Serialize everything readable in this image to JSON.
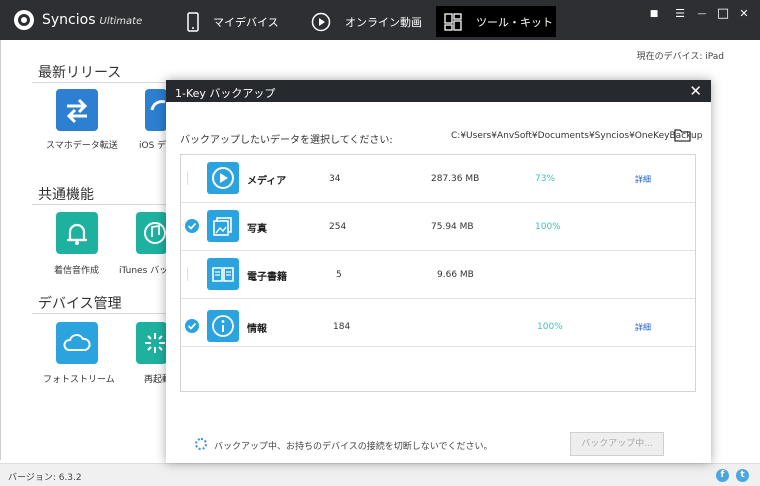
{
  "app": {
    "name": "Syncios",
    "edition": "Ultimate"
  },
  "nav": {
    "tabs": [
      {
        "label": "マイデバイス",
        "icon": "phone-icon"
      },
      {
        "label": "オンライン動画",
        "icon": "play-circle-icon"
      },
      {
        "label": "ツール・キット",
        "icon": "toolkit-icon"
      }
    ],
    "active_tab": 2
  },
  "window_controls": {
    "feedback": "■",
    "menu": "☰",
    "minimize": "—",
    "maximize": "□",
    "close": "✕"
  },
  "page": {
    "current_device": "現在のデバイス: iPad",
    "sections": [
      {
        "title": "最新リリース",
        "tools": [
          {
            "label": "スマホデータ転送",
            "icon": "transfer-arrows-icon",
            "color": "#2c7fd1"
          },
          {
            "label": "iOS デー",
            "icon": "ios-restore-icon",
            "color": "#2c7fd1"
          }
        ]
      },
      {
        "title": "共通機能",
        "tools": [
          {
            "label": "着信音作成",
            "icon": "bell-icon",
            "color": "#1fb1a0"
          },
          {
            "label": "iTunes バック",
            "icon": "music-note-icon",
            "color": "#1fb1a0"
          }
        ]
      },
      {
        "title": "デバイス管理",
        "tools": [
          {
            "label": "フォトストリーム",
            "icon": "cloud-icon",
            "color": "#2aa3df"
          },
          {
            "label": "再起動",
            "icon": "restart-icon",
            "color": "#1fb1a0"
          }
        ]
      }
    ]
  },
  "status_bar": {
    "version": "バージョン: 6.3.2",
    "social": [
      {
        "icon": "facebook-icon",
        "glyph": "f"
      },
      {
        "icon": "twitter-icon",
        "glyph": "t"
      }
    ]
  },
  "dialog": {
    "title": "1-Key バックアップ",
    "close": "✕",
    "prompt": "バックアップしたいデータを選択してください:",
    "path": "C:¥Users¥AnvSoft¥Documents¥Syncios¥OneKeyBackup",
    "rows": [
      {
        "name": "メディア",
        "count": "34",
        "size": "287.36 MB",
        "progress": "73%",
        "detail": "詳細",
        "checked": false,
        "icon": "media-play-icon"
      },
      {
        "name": "写真",
        "count": "254",
        "size": "75.94 MB",
        "progress": "100%",
        "detail": "",
        "checked": true,
        "icon": "photo-icon"
      },
      {
        "name": "電子書籍",
        "count": "5",
        "size": "9.66 MB",
        "progress": "",
        "detail": "",
        "checked": false,
        "icon": "book-icon"
      },
      {
        "name": "情報",
        "count": "184",
        "size": "",
        "progress": "100%",
        "detail": "詳細",
        "checked": true,
        "icon": "info-icon"
      }
    ],
    "footer_message": "バックアップ中、お持ちのデバイスの接続を切断しないでください。",
    "footer_button": "バックアップ中..."
  }
}
